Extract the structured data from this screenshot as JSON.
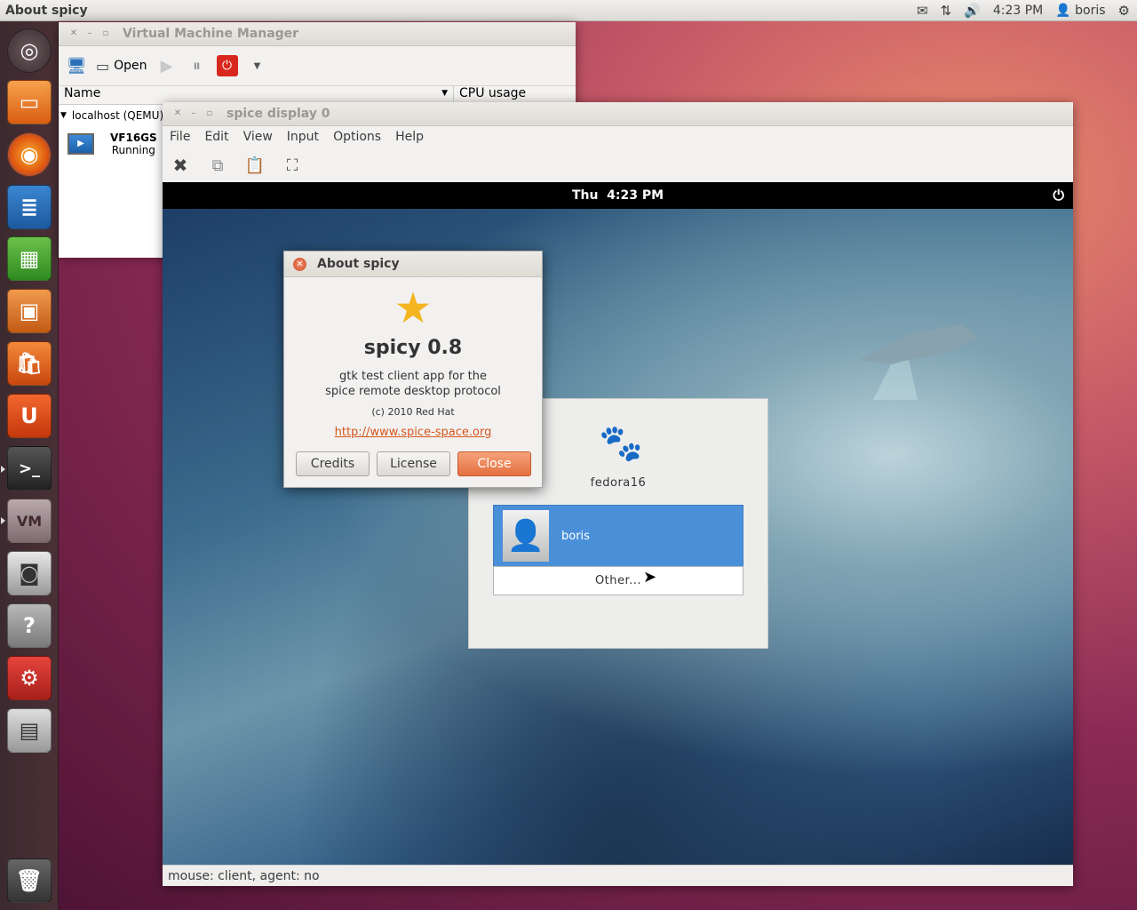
{
  "panel": {
    "app_title": "About spicy",
    "clock": "4:23 PM",
    "user": "boris"
  },
  "launcher": {
    "items": [
      "dash-home",
      "files",
      "firefox",
      "writer",
      "calc",
      "impress",
      "software-center",
      "ubuntu-one",
      "terminal",
      "virt-manager",
      "camera",
      "help",
      "system-settings",
      "workspaces",
      "trash"
    ]
  },
  "vmm": {
    "title": "Virtual Machine Manager",
    "open_label": "Open",
    "col_name": "Name",
    "col_cpu": "CPU usage",
    "host": "localhost (QEMU)",
    "vm_name": "VF16GS",
    "vm_status": "Running"
  },
  "spice": {
    "title": "spice display 0",
    "menu": [
      "File",
      "Edit",
      "View",
      "Input",
      "Options",
      "Help"
    ],
    "guest_clock": "Thu  4:23 PM",
    "status": "mouse: client, agent: no",
    "login": {
      "hostname": "fedora16",
      "user": "boris",
      "other": "Other..."
    }
  },
  "about": {
    "title": "About spicy",
    "app_name": "spicy 0.8",
    "desc_line1": "gtk test client app for the",
    "desc_line2": "spice remote desktop protocol",
    "copyright": "(c) 2010 Red Hat",
    "url": "http://www.spice-space.org",
    "btn_credits": "Credits",
    "btn_license": "License",
    "btn_close": "Close"
  }
}
